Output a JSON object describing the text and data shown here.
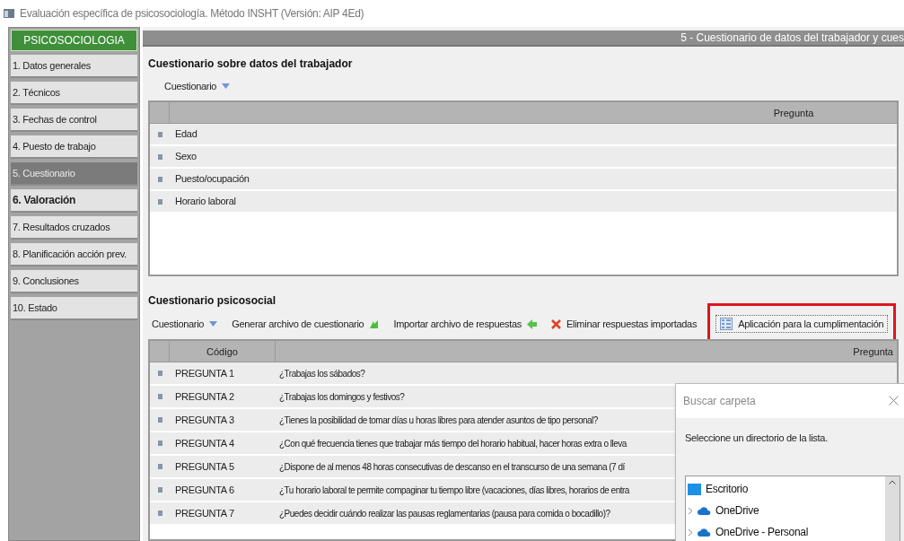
{
  "window": {
    "title": "Evaluación específica de psicosociología. Método INSHT (Versión: AIP 4Ed)"
  },
  "sidebar": {
    "header": "PSICOSOCIOLOGIA",
    "items": [
      {
        "label": "1. Datos generales",
        "selected": false,
        "bold": false
      },
      {
        "label": "2. Técnicos",
        "selected": false,
        "bold": false
      },
      {
        "label": "3. Fechas de control",
        "selected": false,
        "bold": false
      },
      {
        "label": "4. Puesto de trabajo",
        "selected": false,
        "bold": false
      },
      {
        "label": "5. Cuestionario",
        "selected": true,
        "bold": false
      },
      {
        "label": "6. Valoración",
        "selected": false,
        "bold": true
      },
      {
        "label": "7. Resultados cruzados",
        "selected": false,
        "bold": false
      },
      {
        "label": "8. Planificación acción prev.",
        "selected": false,
        "bold": false
      },
      {
        "label": "9. Conclusiones",
        "selected": false,
        "bold": false
      },
      {
        "label": "10. Estado",
        "selected": false,
        "bold": false
      }
    ]
  },
  "header_bar": {
    "title": "5 - Cuestionario de datos del trabajador y cues"
  },
  "worker_section": {
    "title": "Cuestionario sobre datos del trabajador",
    "toolbar": [
      {
        "label": "Cuestionario",
        "kind": "dropdown",
        "highlighted": false
      }
    ],
    "table": {
      "columns": [
        "Pregunta"
      ],
      "rows": [
        "Edad",
        "Sexo",
        "Puesto/ocupación",
        "Horario laboral"
      ]
    }
  },
  "psychosocial_section": {
    "title": "Cuestionario psicosocial",
    "toolbar": [
      {
        "label": "Cuestionario",
        "kind": "dropdown",
        "highlighted": false
      },
      {
        "label": "Generar archivo de cuestionario",
        "kind": "export",
        "highlighted": false
      },
      {
        "label": "Importar archivo de respuestas",
        "kind": "import",
        "highlighted": false
      },
      {
        "label": "Eliminar respuestas importadas",
        "kind": "delete",
        "highlighted": false
      },
      {
        "label": "Aplicación para la cumplimentación",
        "kind": "app",
        "highlighted": true
      }
    ],
    "table": {
      "columns": [
        "Código",
        "Pregunta"
      ],
      "rows": [
        {
          "code": "PREGUNTA 1",
          "question": "¿Trabajas los sábados?"
        },
        {
          "code": "PREGUNTA 2",
          "question": "¿Trabajas los domingos y festivos?"
        },
        {
          "code": "PREGUNTA 3",
          "question": "¿Tienes la posibilidad de tomar días u horas libres para atender asuntos de tipo personal?"
        },
        {
          "code": "PREGUNTA 4",
          "question": "¿Con qué frecuencia tienes que trabajar más tiempo del horario habitual, hacer horas extra o lleva"
        },
        {
          "code": "PREGUNTA 5",
          "question": "¿Dispone de al menos 48 horas consecutivas de descanso en el transcurso de una semana (7 dí"
        },
        {
          "code": "PREGUNTA 6",
          "question": "¿Tu horario laboral te permite compaginar tu tiempo libre (vacaciones, días libres, horarios de entra"
        },
        {
          "code": "PREGUNTA 7",
          "question": "¿Puedes decidir cuándo realizar las pausas reglamentarias (pausa para comida o bocadillo)?"
        }
      ]
    }
  },
  "dialog": {
    "title": "Buscar carpeta",
    "message": "Seleccione un directorio de la lista.",
    "tree": [
      {
        "label": "Escritorio",
        "kind": "desktop",
        "expandable": false
      },
      {
        "label": "OneDrive",
        "kind": "cloud",
        "expandable": true
      },
      {
        "label": "OneDrive - Personal",
        "kind": "cloud",
        "expandable": true
      }
    ]
  }
}
